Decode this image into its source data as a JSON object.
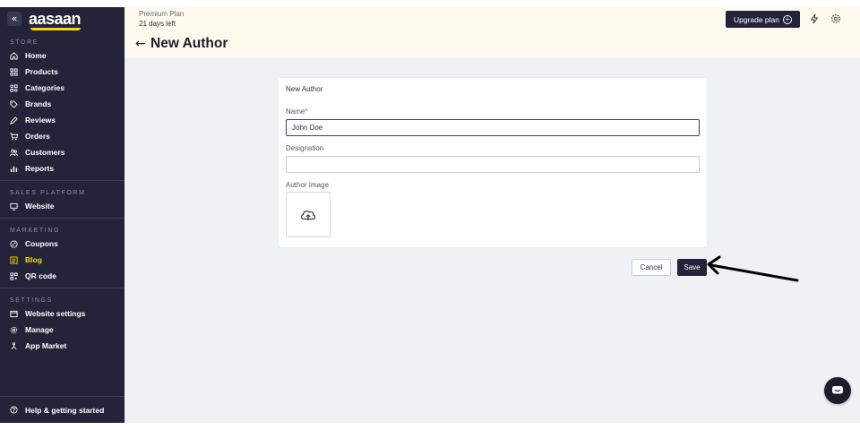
{
  "sidebar": {
    "logo": "aasaan",
    "collapse_icon": "«",
    "sections": {
      "store": "STORE",
      "sales_platform": "SALES PLATFORM",
      "marketing": "MARKETING",
      "settings": "SETTINGS"
    },
    "store_items": [
      {
        "label": "Home",
        "icon": "home-icon"
      },
      {
        "label": "Products",
        "icon": "grid-icon"
      },
      {
        "label": "Categories",
        "icon": "categories-icon"
      },
      {
        "label": "Brands",
        "icon": "tag-icon"
      },
      {
        "label": "Reviews",
        "icon": "edit-icon"
      },
      {
        "label": "Orders",
        "icon": "cart-icon"
      },
      {
        "label": "Customers",
        "icon": "users-icon"
      },
      {
        "label": "Reports",
        "icon": "bar-chart-icon"
      }
    ],
    "sales_items": [
      {
        "label": "Website",
        "icon": "monitor-icon"
      }
    ],
    "marketing_items": [
      {
        "label": "Coupons",
        "icon": "percent-icon"
      },
      {
        "label": "Blog",
        "icon": "blog-icon",
        "active": true
      },
      {
        "label": "QR code",
        "icon": "qr-icon"
      }
    ],
    "settings_items": [
      {
        "label": "Website settings",
        "icon": "website-settings-icon"
      },
      {
        "label": "Manage",
        "icon": "gear-icon"
      },
      {
        "label": "App Market",
        "icon": "app-market-icon"
      }
    ],
    "help_label": "Help & getting started",
    "active_color": "#f5d90a"
  },
  "header": {
    "plan_label": "Premium Plan",
    "plan_days": "21 days left",
    "page_title": "New Author",
    "upgrade_label": "Upgrade plan"
  },
  "form": {
    "card_title": "New Author",
    "name_label": "Name*",
    "name_value": "John Doe",
    "designation_label": "Designation",
    "designation_value": "",
    "image_label": "Author Image",
    "cancel_label": "Cancel",
    "save_label": "Save"
  },
  "colors": {
    "sidebar_bg": "#23243a",
    "header_bg": "#fdf9ec",
    "main_bg": "#eff2f5",
    "accent": "#f5d90a"
  }
}
